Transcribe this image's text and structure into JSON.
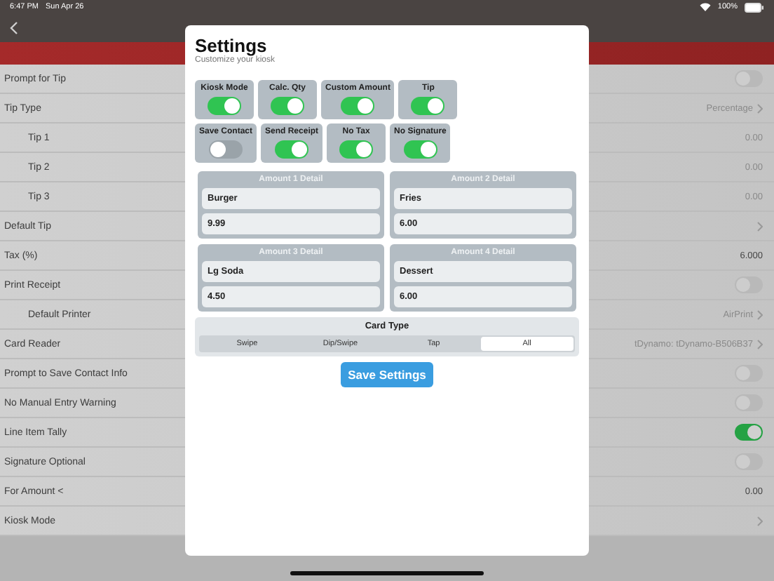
{
  "status_bar": {
    "time": "6:47 PM",
    "date": "Sun Apr 26",
    "battery": "100%"
  },
  "settings_list": [
    {
      "label": "Prompt for Tip",
      "kind": "toggle",
      "on": false
    },
    {
      "label": "Tip Type",
      "kind": "link",
      "value": "Percentage",
      "children": [
        {
          "label": "Tip 1",
          "kind": "value",
          "value": "0.00"
        },
        {
          "label": "Tip 2",
          "kind": "value",
          "value": "0.00"
        },
        {
          "label": "Tip 3",
          "kind": "value",
          "value": "0.00"
        }
      ]
    },
    {
      "label": "Default Tip",
      "kind": "link"
    },
    {
      "label": "Tax (%)",
      "kind": "value",
      "value": "6.000"
    },
    {
      "label": "Print Receipt",
      "kind": "toggle",
      "on": false,
      "children": [
        {
          "label": "Default Printer",
          "kind": "link",
          "value": "AirPrint"
        }
      ]
    },
    {
      "label": "Card Reader",
      "kind": "link",
      "value": "tDynamo: tDynamo-B506B37"
    },
    {
      "label": "Prompt to Save Contact Info",
      "kind": "toggle",
      "on": false
    },
    {
      "label": "No Manual Entry Warning",
      "kind": "toggle",
      "on": false
    },
    {
      "label": "Line Item Tally",
      "kind": "toggle",
      "on": true
    },
    {
      "label": "Signature Optional",
      "kind": "toggle",
      "on": false
    },
    {
      "label": "For Amount <",
      "kind": "value",
      "value": "0.00"
    },
    {
      "label": "Kiosk Mode",
      "kind": "link"
    }
  ],
  "dialog": {
    "title": "Settings",
    "subtitle": "Customize your kiosk",
    "switch_rows": [
      [
        {
          "label": "Kiosk Mode",
          "on": true
        },
        {
          "label": "Calc. Qty",
          "on": true
        },
        {
          "label": "Custom Amount",
          "on": true
        },
        {
          "label": "Tip",
          "on": true
        }
      ],
      [
        {
          "label": "Save Contact",
          "on": false
        },
        {
          "label": "Send Receipt",
          "on": true
        },
        {
          "label": "No Tax",
          "on": true
        },
        {
          "label": "No Signature",
          "on": true
        }
      ]
    ],
    "amounts": [
      {
        "title": "Amount 1 Detail",
        "name": "Burger",
        "price": "9.99"
      },
      {
        "title": "Amount 2 Detail",
        "name": "Fries",
        "price": "6.00"
      },
      {
        "title": "Amount 3 Detail",
        "name": "Lg Soda",
        "price": "4.50"
      },
      {
        "title": "Amount 4 Detail",
        "name": "Dessert",
        "price": "6.00"
      }
    ],
    "card_type": {
      "title": "Card Type",
      "options": [
        {
          "label": "Swipe",
          "selected": false
        },
        {
          "label": "Dip/Swipe",
          "selected": false
        },
        {
          "label": "Tap",
          "selected": false
        },
        {
          "label": "All",
          "selected": true
        }
      ]
    },
    "save_button": "Save Settings"
  }
}
